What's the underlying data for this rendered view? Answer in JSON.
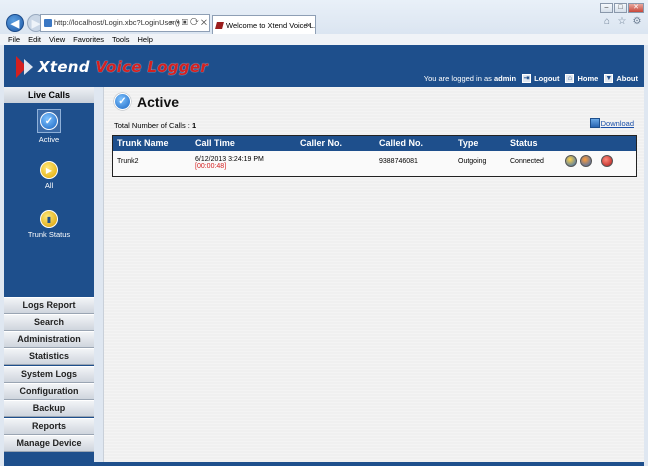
{
  "browser": {
    "address": "http://localhost/Login.xbc?LoginUser()",
    "address_tools": "⌕ ▾ ▣ ⟳ ✕",
    "tab_title": "Welcome to Xtend Voice L...",
    "menu": [
      "File",
      "Edit",
      "View",
      "Favorites",
      "Tools",
      "Help"
    ]
  },
  "header": {
    "logo_x": "Xtend",
    "logo_rest": " Voice Logger",
    "logged_in_prefix": "You are logged in as",
    "user": "admin",
    "links": {
      "logout": "Logout",
      "home": "Home",
      "about": "About"
    }
  },
  "sidebar": {
    "section": "Live Calls",
    "items": [
      {
        "label": "Active"
      },
      {
        "label": "All"
      },
      {
        "label": "Trunk Status"
      }
    ],
    "menu": [
      "Logs Report",
      "Search",
      "Administration",
      "Statistics",
      "System Logs",
      "Configuration",
      "Backup",
      "Reports",
      "Manage Device"
    ]
  },
  "main": {
    "title": "Active",
    "total_label": "Total Number of Calls :",
    "total_value": "1",
    "download": "Download",
    "columns": [
      "Trunk Name",
      "Call Time",
      "Caller No.",
      "Called No.",
      "Type",
      "Status"
    ],
    "rows": [
      {
        "trunk": "Trunk2",
        "call_time": "6/12/2013 3:24:19 PM",
        "duration": "[00:00:48]",
        "caller": "",
        "called": "9388746081",
        "type": "Outgoing",
        "status": "Connected"
      }
    ]
  },
  "colors": {
    "brand_blue": "#1e4f8c",
    "accent_red": "#d42020"
  }
}
